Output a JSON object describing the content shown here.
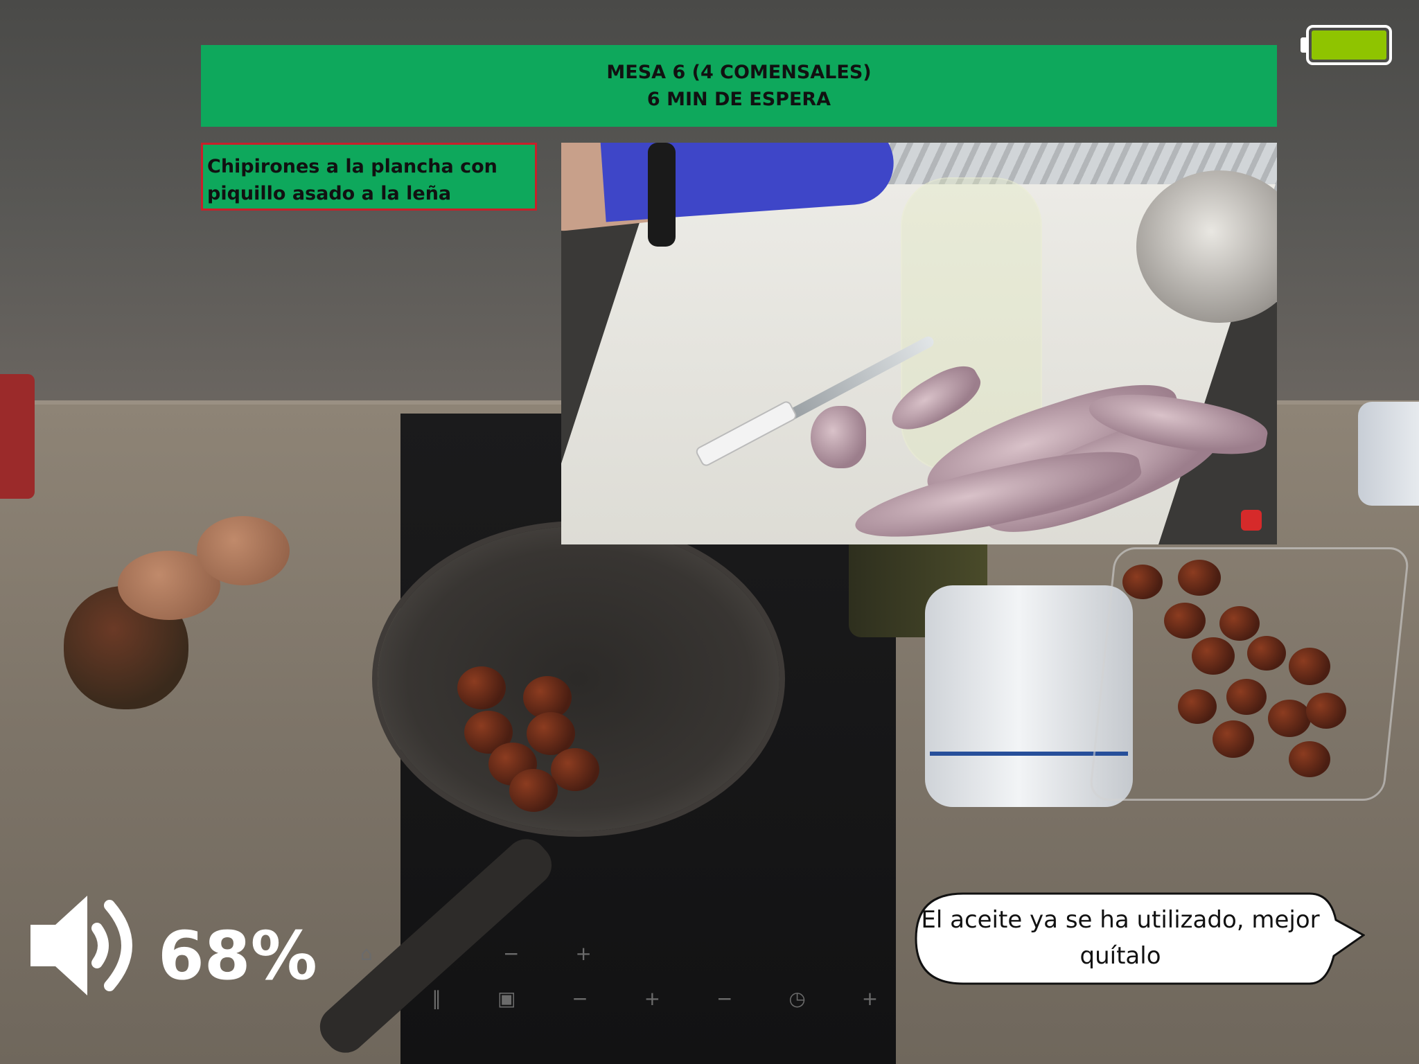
{
  "table_header": {
    "line1": "MESA 6 (4 COMENSALES)",
    "line2": "6 MIN DE ESPERA",
    "color": "#0ea85c"
  },
  "dish": {
    "name": "Chipirones a la plancha con piquillo asado a la leña",
    "border_color": "#c8202a"
  },
  "video_preview": {
    "label": "Cleaning squid reference video"
  },
  "volume": {
    "icon": "speaker-icon",
    "value": "68%"
  },
  "battery": {
    "icon": "battery-icon",
    "level": 1.0,
    "color": "#8fc400"
  },
  "assistant_message": {
    "text": "El aceite ya se ha utilizado, mejor quítalo"
  }
}
